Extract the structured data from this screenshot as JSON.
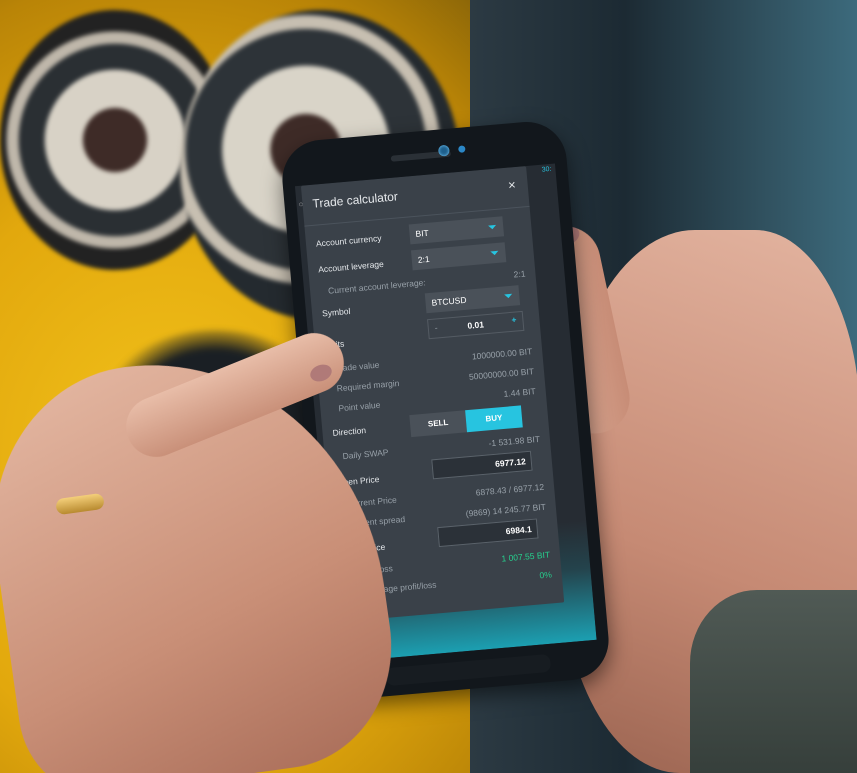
{
  "scene": {
    "description_colors": {
      "accent": "#27c4e0",
      "profit": "#26d08e",
      "panel": "#3a4149"
    }
  },
  "phone": {
    "status_text": "30:",
    "calculator": {
      "title": "Trade calculator",
      "close_icon": "×",
      "account_currency": {
        "label": "Account currency",
        "value": "BIT"
      },
      "account_leverage": {
        "label": "Account leverage",
        "value": "2:1"
      },
      "current_account_leverage": {
        "label": "Current account leverage:",
        "value": "2:1"
      },
      "symbol": {
        "label": "Symbol",
        "value": "BTCUSD"
      },
      "units": {
        "label": "Units",
        "minus": "-",
        "value": "0.01",
        "plus": "+"
      },
      "trade_value": {
        "label": "Trade value",
        "value": "1000000.00 BIT"
      },
      "required_margin": {
        "label": "Required margin",
        "value": "50000000.00 BIT"
      },
      "point_value": {
        "label": "Point value",
        "value": "1.44 BIT"
      },
      "direction": {
        "label": "Direction",
        "sell": "SELL",
        "buy": "BUY"
      },
      "daily_swap": {
        "label": "Daily SWAP",
        "value": "-1 531.98 BIT"
      },
      "open_price": {
        "label": "Open Price",
        "value": "6977.12"
      },
      "current_price": {
        "label": "Current Price",
        "value": "6878.43 / 6977.12"
      },
      "current_spread": {
        "label": "Current spread",
        "value": "(9869) 14 245.77 BIT"
      },
      "close_price": {
        "label": "Close price",
        "value": "6984.1"
      },
      "profit_loss": {
        "label": "Profit/Loss",
        "value": "1 007.55 BIT"
      },
      "percentage_profit_loss": {
        "label": "Percentage profit/loss",
        "value": "0%"
      }
    }
  }
}
